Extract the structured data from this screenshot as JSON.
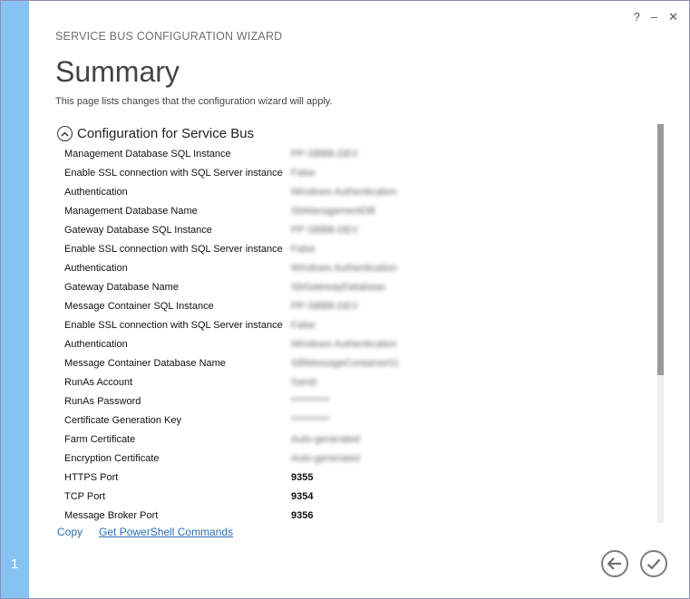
{
  "window": {
    "step_number": "1",
    "help_glyph": "?",
    "minimize_glyph": "–",
    "close_glyph": "✕"
  },
  "header": {
    "wizard_title": "SERVICE BUS CONFIGURATION WIZARD",
    "page_title": "Summary",
    "description": "This page lists changes that the configuration wizard will apply."
  },
  "section": {
    "title": "Configuration for Service Bus",
    "rows": [
      {
        "label": "Management Database SQL Instance",
        "value": "PP-SBBB-DEV"
      },
      {
        "label": "Enable SSL connection with SQL Server instance",
        "value": "False"
      },
      {
        "label": "Authentication",
        "value": "Windows Authentication"
      },
      {
        "label": "Management Database Name",
        "value": "SbManagementDB"
      },
      {
        "label": "Gateway Database SQL Instance",
        "value": "PP-SBBB-DEV"
      },
      {
        "label": "Enable SSL connection with SQL Server instance",
        "value": "False"
      },
      {
        "label": "Authentication",
        "value": "Windows Authentication"
      },
      {
        "label": "Gateway Database Name",
        "value": "SbGatewayDatabase"
      },
      {
        "label": "Message Container SQL Instance",
        "value": "PP-SBBB-DEV"
      },
      {
        "label": "Enable SSL connection with SQL Server instance",
        "value": "False"
      },
      {
        "label": "Authentication",
        "value": "Windows Authentication"
      },
      {
        "label": "Message Container Database Name",
        "value": "SBMessageContainer01"
      },
      {
        "label": "RunAs Account",
        "value": "Sandi"
      },
      {
        "label": "RunAs Password",
        "value": "**********"
      },
      {
        "label": "Certificate Generation Key",
        "value": "**********"
      },
      {
        "label": "Farm Certificate",
        "value": "Auto-generated"
      },
      {
        "label": "Encryption Certificate",
        "value": "Auto-generated"
      },
      {
        "label": "HTTPS Port",
        "value": "9355"
      },
      {
        "label": "TCP Port",
        "value": "9354"
      },
      {
        "label": "Message Broker Port",
        "value": "9356"
      }
    ]
  },
  "links": {
    "copy": "Copy",
    "powershell": "Get PowerShell Commands"
  },
  "icons": {
    "collapse": "chevron-up-circle-icon",
    "back": "back-arrow-icon",
    "finish": "checkmark-icon"
  }
}
